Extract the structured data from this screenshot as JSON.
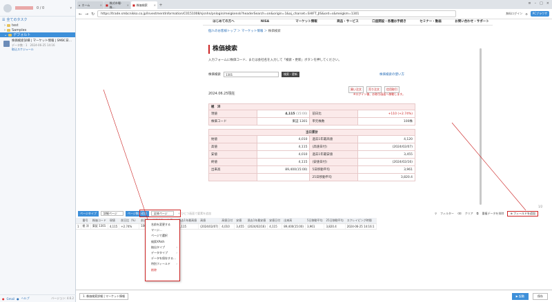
{
  "sidebar": {
    "account_name": "0 / 0",
    "section_label": "全てのタスク",
    "tree": [
      {
        "label": "test"
      },
      {
        "label": "Samples"
      },
      {
        "label": "デフォルト"
      }
    ],
    "task": {
      "title": "株価検索詳細 | マーケット情報 | SMBC日…",
      "meta": "データ数 : 1",
      "date": "2024-06-25 14:16",
      "sub": "取込スケジュール"
    },
    "footer": {
      "a": "Gmail",
      "b": "ヘルプ",
      "version": "バージョン: 4.6.2"
    }
  },
  "browser": {
    "tabs": [
      {
        "label": "ホーム"
      },
      {
        "label": "株式市場-株…"
      },
      {
        "label": "株価検索"
      }
    ],
    "url": "https://trade.smbcnikko.co.jp/InvestmentInformation/C0151008/sjsnhn/pnlogin/meigkensk?headerSearch=on&origin=1&aj_charset=SHIFT_JIS&ord=s&meigkm=1301",
    "tools": {
      "a": "無料ログイン",
      "b": "PCブラウザ"
    }
  },
  "site": {
    "nav": [
      "はじめての方へ",
      "NISA",
      "マーケット情報",
      "商品・サービス",
      "口座開設・各種お手続き",
      "セミナー・動画",
      "お問い合わせ・サポート"
    ],
    "breadcrumb": {
      "home": "個人のお客様トップ",
      "section": "マーケット情報",
      "current": "株価検索"
    },
    "title": "株価検索",
    "description": "入力フォームに株価コード、または会社名を入力して「検索・更新」ボタンを押してください。",
    "search": {
      "label": "株価検索",
      "value": "1301",
      "button": "検索・更新"
    },
    "help": "株価検索の使い方",
    "date": "2024.06.25現在",
    "actions": [
      "買い注文",
      "売り注文",
      "信用取引"
    ],
    "login_note": "※ログイン後、お取引画面へ移動します。",
    "quote": {
      "header": "極　洋",
      "rows": [
        {
          "l1": "現値",
          "v1": "4,115",
          "t1": "(15:00)",
          "l2": "前日比",
          "v2": "+110 (+2.74%)"
        },
        {
          "l1": "株価コード",
          "v1": "東証 1301",
          "t1": "",
          "l2": "単元株数",
          "v2": "100株"
        }
      ],
      "section": "当日累計",
      "rows2": [
        {
          "l1": "始値",
          "v1": "4,010",
          "l2": "過去1年最高値",
          "v2": "4,120"
        },
        {
          "l1": "高値",
          "v1": "4,115",
          "l2": "(高値日付)",
          "v2": "(2024/02/07)"
        },
        {
          "l1": "安値",
          "v1": "4,010",
          "l2": "過去1年最安値",
          "v2": "3,455"
        },
        {
          "l1": "終値",
          "v1": "4,115",
          "l2": "(安値日付)",
          "v2": "(2024/02/16)"
        },
        {
          "l1": "出来高",
          "v1": "89,400(15:00)",
          "l2": "5日移動平均",
          "v2": "3,961"
        },
        {
          "l1": "",
          "v1": "",
          "l2": "25日移動平均",
          "v2": "3,820.4"
        }
      ]
    }
  },
  "toolbar": {
    "mode": "ページタイプ",
    "page_dd": "詳細ページ",
    "active": "ページ数の追加",
    "dd2": "全体ページ",
    "link": "+ ひとつ画面で要素を追加",
    "filter": "フィルター",
    "clear": "クリア",
    "sep": "重複データを排除",
    "field": "フィールドを追加"
  },
  "grid": {
    "headers": [
      "番号",
      "株価コード",
      "現値",
      "前日比（%）",
      "前日比",
      "単元株数",
      "始値",
      "過去1年最高値",
      "高値",
      "高値日付",
      "安値",
      "過去1年最安値",
      "安値日付",
      "出来高",
      "5日移動平均",
      "25日移動平均",
      "スクレイピング時間"
    ],
    "row": [
      "1",
      "極 洋",
      "東証 1301",
      "4,115",
      "+2.74%",
      "100株",
      "4,010",
      "4,120",
      "4,115",
      "(2024/02/07)",
      "4,010",
      "3,455",
      "(2024/02/16)",
      "4,115",
      "89,400(15:00)",
      "3,961",
      "3,820.4",
      "2024-06-25 14:16:1"
    ]
  },
  "context_menu": [
    "名前を変更する",
    "マージ…",
    "ページで選択",
    "検索XPath",
    "抽出タイプ",
    "データタイプ",
    "データを保存する…",
    "特別フィールド",
    "削除"
  ],
  "splitter": "1/2",
  "bottom": {
    "tab": "1. 株価検索詳細 | マーケット情報",
    "start": "起動",
    "save": "保存"
  }
}
